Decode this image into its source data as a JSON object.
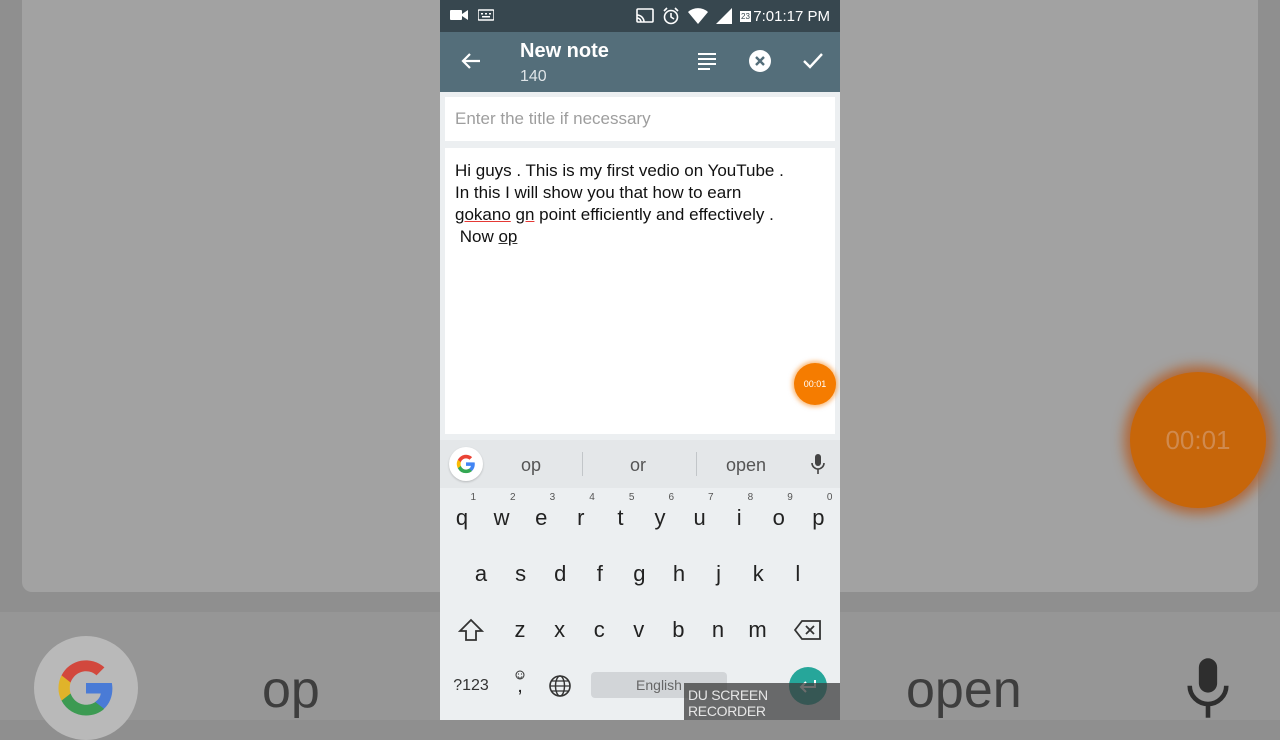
{
  "status": {
    "time": "7:01:17 PM",
    "sim": "23"
  },
  "appbar": {
    "title": "New note",
    "count": "140"
  },
  "note": {
    "title_placeholder": "Enter the title if necessary",
    "lines": [
      "Hi guys . This is my first vedio on YouTube .",
      "In this I will show you that how to earn"
    ],
    "line3_err1": "gokano",
    "line3_err2": "gn",
    "line3_rest": " point efficiently and effectively .",
    "line4_prefix": " Now ",
    "line4_current": "op"
  },
  "recorder": {
    "timer": "00:01",
    "watermark": "DU SCREEN RECORDER"
  },
  "keyboard": {
    "suggestions": [
      "op",
      "or",
      "open"
    ],
    "row1": [
      {
        "k": "q",
        "n": "1"
      },
      {
        "k": "w",
        "n": "2"
      },
      {
        "k": "e",
        "n": "3"
      },
      {
        "k": "r",
        "n": "4"
      },
      {
        "k": "t",
        "n": "5"
      },
      {
        "k": "y",
        "n": "6"
      },
      {
        "k": "u",
        "n": "7"
      },
      {
        "k": "i",
        "n": "8"
      },
      {
        "k": "o",
        "n": "9"
      },
      {
        "k": "p",
        "n": "0"
      }
    ],
    "row2": [
      "a",
      "s",
      "d",
      "f",
      "g",
      "h",
      "j",
      "k",
      "l"
    ],
    "row3": [
      "z",
      "x",
      "c",
      "v",
      "b",
      "n",
      "m"
    ],
    "symbols_label": "?123",
    "emoji_comma": ",",
    "space_label": "English"
  },
  "colors": {
    "appbar": "#546e7a",
    "statusbar": "#37474f",
    "recorder": "#f57c00",
    "enter": "#26a69a",
    "error_underline": "#e53935"
  }
}
